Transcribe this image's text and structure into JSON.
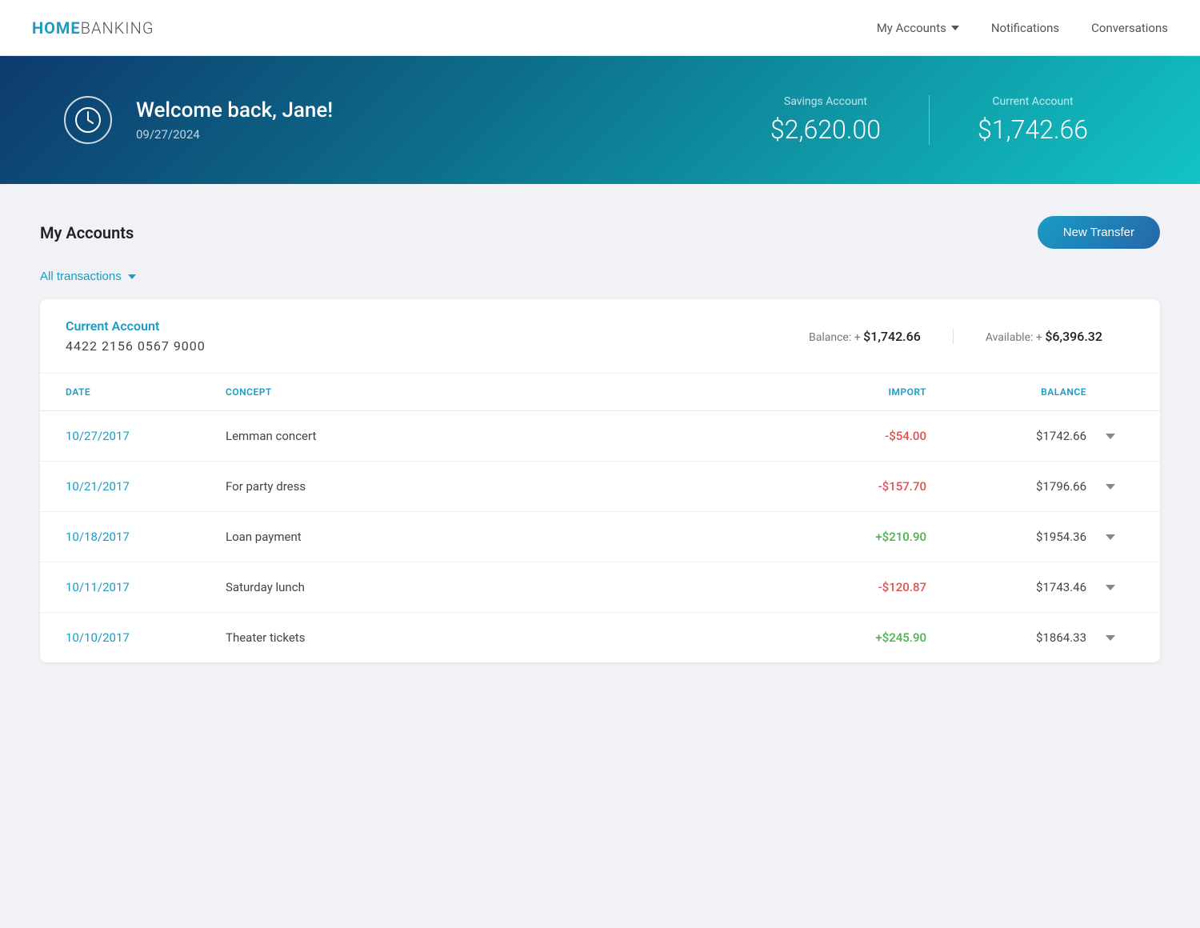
{
  "header": {
    "logo_bold": "HOME",
    "logo_light": "BANKING",
    "nav": {
      "accounts_label": "My Accounts",
      "notifications_label": "Notifications",
      "conversations_label": "Conversations"
    }
  },
  "hero": {
    "welcome_message": "Welcome back, Jane!",
    "date": "09/27/2024",
    "savings_label": "Savings Account",
    "savings_value": "$2,620.00",
    "current_label": "Current Account",
    "current_value": "$1,742.66"
  },
  "main": {
    "section_title": "My Accounts",
    "new_transfer_label": "New Transfer",
    "filter_label": "All transactions",
    "account": {
      "name": "Current Account",
      "number": "4422 2156 0567 9000",
      "balance_label": "Balance: +",
      "balance_value": "$1,742.66",
      "available_label": "Available: +",
      "available_value": "$6,396.32"
    },
    "table": {
      "headers": {
        "date": "DATE",
        "concept": "CONCEPT",
        "import": "IMPORT",
        "balance": "BALANCE"
      },
      "rows": [
        {
          "date": "10/27/2017",
          "concept": "Lemman concert",
          "import": "-$54.00",
          "import_type": "negative",
          "balance": "$1742.66"
        },
        {
          "date": "10/21/2017",
          "concept": "For party dress",
          "import": "-$157.70",
          "import_type": "negative",
          "balance": "$1796.66"
        },
        {
          "date": "10/18/2017",
          "concept": "Loan payment",
          "import": "+$210.90",
          "import_type": "positive",
          "balance": "$1954.36"
        },
        {
          "date": "10/11/2017",
          "concept": "Saturday lunch",
          "import": "-$120.87",
          "import_type": "negative",
          "balance": "$1743.46"
        },
        {
          "date": "10/10/2017",
          "concept": "Theater tickets",
          "import": "+$245.90",
          "import_type": "positive",
          "balance": "$1864.33"
        }
      ]
    }
  }
}
